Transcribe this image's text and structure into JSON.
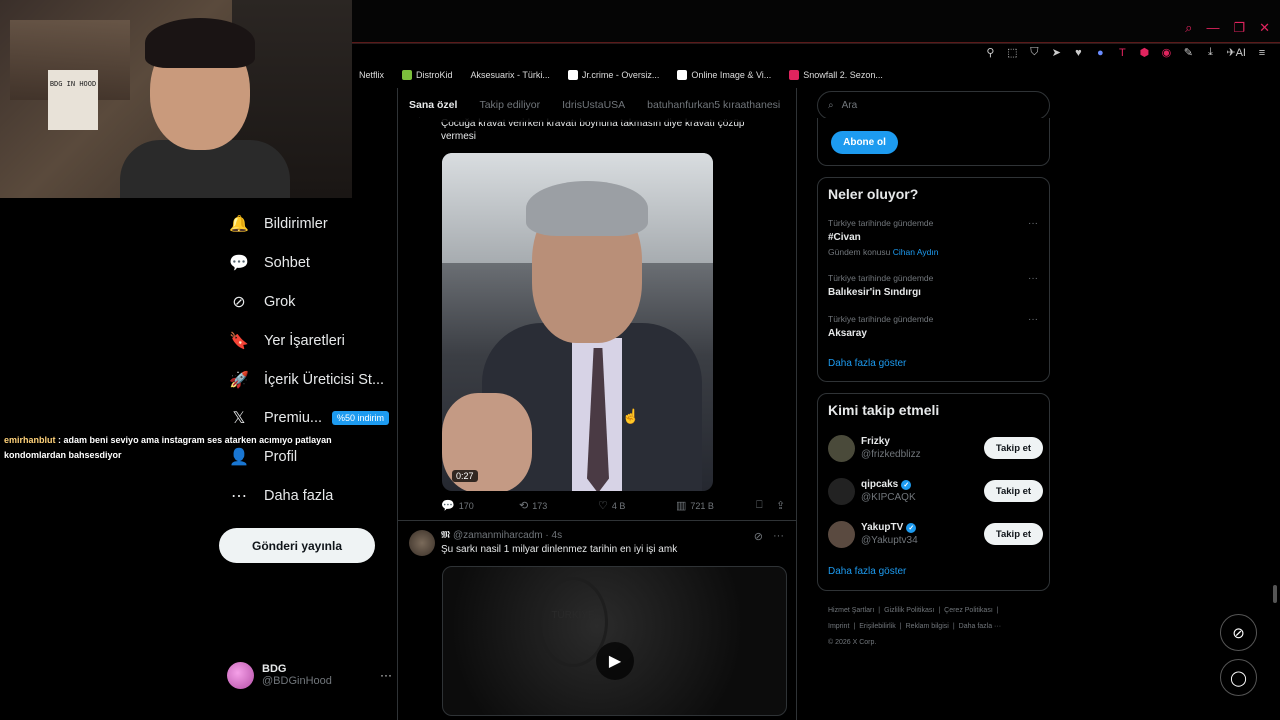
{
  "browser": {
    "bookmarks": [
      {
        "label": "Netflix",
        "color": ""
      },
      {
        "label": "DistroKid",
        "color": "#7cc03c"
      },
      {
        "label": "Aksesuarix - Türki...",
        "color": ""
      },
      {
        "label": "Jr.crime - Oversiz...",
        "color": "#ffffff"
      },
      {
        "label": "Online Image & Vi...",
        "color": "#ffffff"
      },
      {
        "label": "Snowfall 2. Sezon...",
        "color": "#e0245e"
      }
    ],
    "toolbar_ai_label": "AI"
  },
  "webcam": {
    "sign_text": "BDG IN HOOD"
  },
  "nav": {
    "items": [
      {
        "label": "Bildirimler",
        "icon": "bell-icon",
        "glyph": "🔔"
      },
      {
        "label": "Sohbet",
        "icon": "chat-icon",
        "glyph": "💬"
      },
      {
        "label": "Grok",
        "icon": "grok-icon",
        "glyph": "⊘"
      },
      {
        "label": "Yer İşaretleri",
        "icon": "bookmark-icon",
        "glyph": "🔖"
      },
      {
        "label": "İçerik Üreticisi St...",
        "icon": "rocket-icon",
        "glyph": "🚀"
      },
      {
        "label": "Premiu...",
        "icon": "x-icon",
        "glyph": "𝕏",
        "badge": "%50 indirim"
      },
      {
        "label": "Profil",
        "icon": "profile-icon",
        "glyph": "👤"
      },
      {
        "label": "Daha fazla",
        "icon": "more-icon",
        "glyph": "⋯"
      }
    ],
    "post_button": "Gönderi yayınla"
  },
  "chat": {
    "user": "emirhanblut",
    "message": ": adam beni seviyo ama instagram ses atarken acımıyo patlayan kondomlardan bahsesdiyor"
  },
  "account": {
    "name": "BDG",
    "handle": "@BDGinHood",
    "more": "···"
  },
  "timeline": {
    "tabs": [
      "Sana özel",
      "Takip ediliyor",
      "IdrisUstaUSA",
      "batuhanfurkan5 kıraathanesi"
    ],
    "tweet1": {
      "text": "Çocuğa kravat verirken kravatı boynuna takmasın diye kravatı çözüp vermesi",
      "duration": "0:27",
      "replies": "170",
      "retweets": "173",
      "likes": "4 B",
      "views": "721 B"
    },
    "tweet2": {
      "author_icon": "𝕸",
      "handle": "@zamanmiharcadm",
      "time": "· 4s",
      "text": "Şu sarkı nasil 1 milyar dinlenmez tarihin en iyi işi amk",
      "stamp_text": "TÜRKİYE"
    }
  },
  "sidebar": {
    "search_placeholder": "Ara",
    "subscribe_button": "Abone ol",
    "trends_title": "Neler oluyor?",
    "trends": [
      {
        "meta": "Türkiye tarihinde gündemde",
        "name": "#Civan",
        "sub_prefix": "Gündem konusu",
        "sub_link": "Cihan Aydın"
      },
      {
        "meta": "Türkiye tarihinde gündemde",
        "name": "Balıkesir'in Sındırgı",
        "sub_prefix": "",
        "sub_link": ""
      },
      {
        "meta": "Türkiye tarihinde gündemde",
        "name": "Aksaray",
        "sub_prefix": "",
        "sub_link": ""
      }
    ],
    "trends_more": "Daha fazla göster",
    "follow_title": "Kimi takip etmeli",
    "follow": [
      {
        "name": "Frizky",
        "handle": "@frizkedblizz",
        "verified": false,
        "button": "Takip et",
        "avatar_color": "#4a4a3a"
      },
      {
        "name": "qipcaks",
        "handle": "@KIPCAQK",
        "verified": true,
        "button": "Takip et",
        "avatar_color": "#222222"
      },
      {
        "name": "YakupTV",
        "handle": "@Yakuptv34",
        "verified": true,
        "button": "Takip et",
        "avatar_color": "#5a4a40"
      }
    ],
    "follow_more": "Daha fazla göster",
    "footer": [
      "Hizmet Şartları",
      "|",
      "Gizlilik Politikası",
      "|",
      "Çerez Politikası",
      "|",
      "Imprint",
      "|",
      "Erişilebilirlik",
      "|",
      "Reklam bilgisi",
      "|",
      "Daha fazla ···",
      "© 2026 X Corp."
    ]
  }
}
